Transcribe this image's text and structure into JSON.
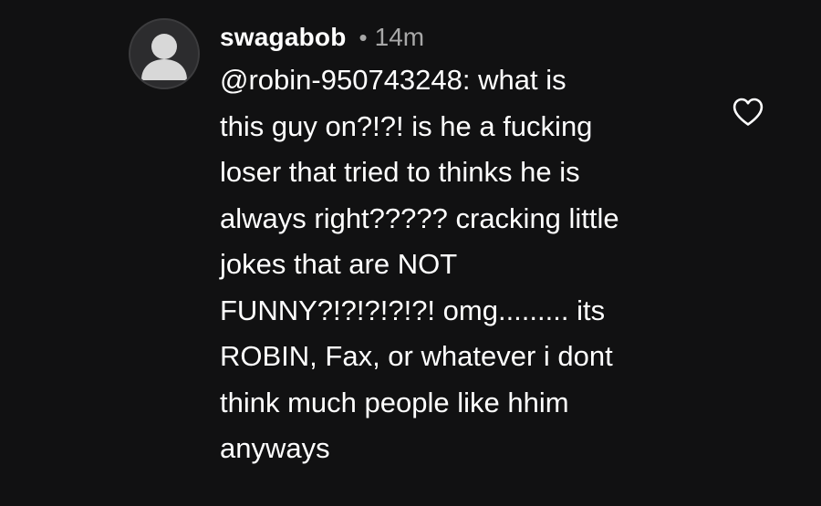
{
  "comment": {
    "username": "swagabob",
    "separator": "•",
    "timestamp": "14m",
    "body_lines": [
      "@robin-950743248: what is",
      "this guy on?!?! is he a fucking",
      "loser that tried to thinks he is",
      "always right????? cracking little",
      "jokes that are NOT",
      "FUNNY?!?!?!?!?! omg......... its",
      "ROBIN, Fax, or whatever i dont",
      "think much people like hhim",
      "anyways"
    ],
    "avatar_icon": "default-user-icon",
    "like_icon": "heart-outline-icon"
  },
  "colors": {
    "background": "#111112",
    "text": "#ffffff",
    "muted": "#a8a8a8",
    "avatar_bg": "#2c2c2e",
    "avatar_fg": "#d8d8d8"
  }
}
